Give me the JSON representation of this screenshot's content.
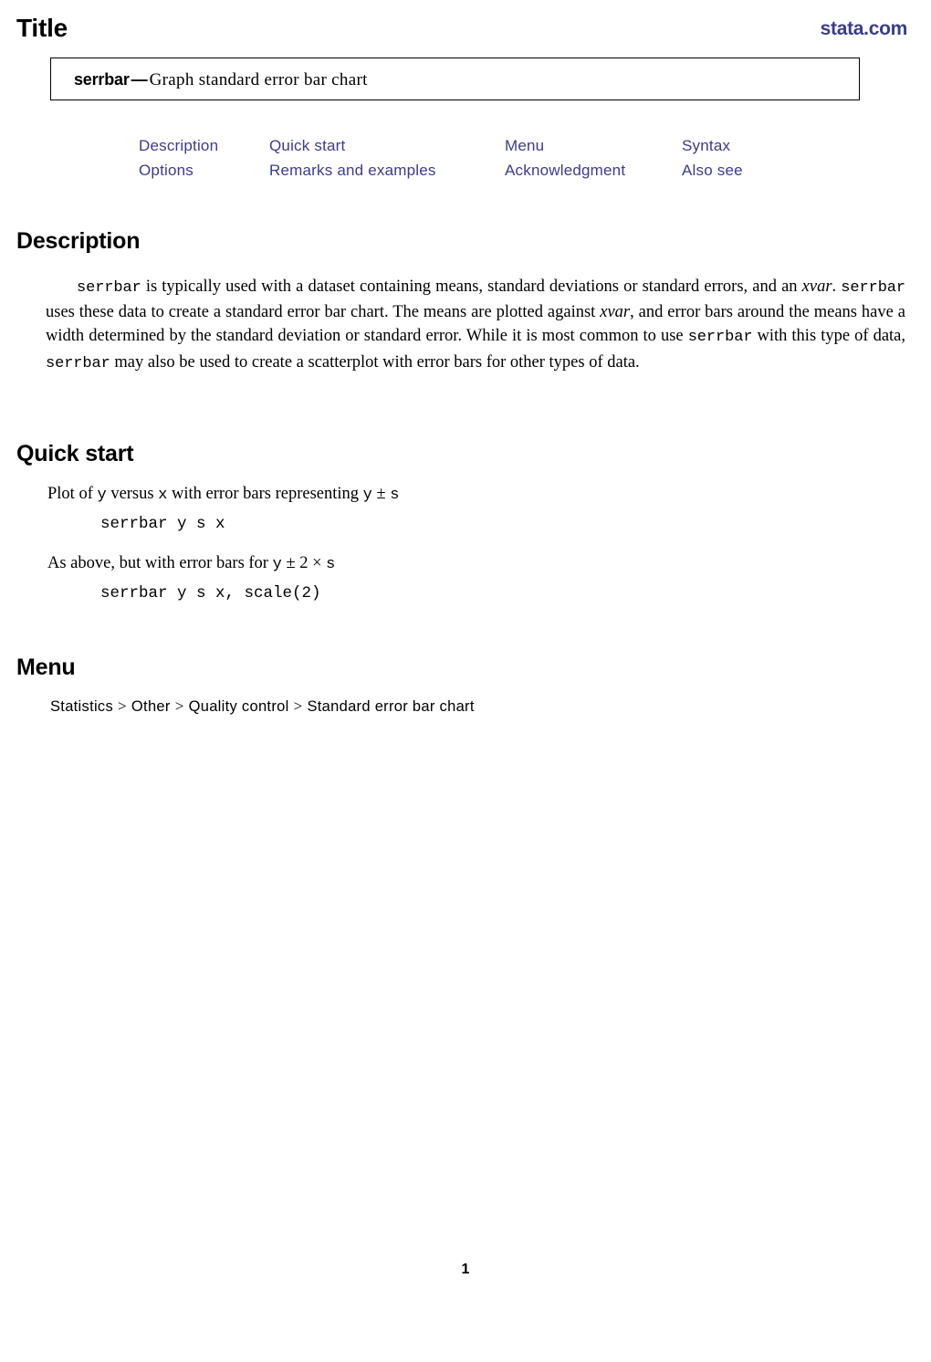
{
  "header": {
    "title": "Title",
    "site_link": "stata.com",
    "link_color": "#3b3b8f"
  },
  "title_box": {
    "command": "serrbar",
    "dash": "—",
    "description": "Graph standard error bar chart"
  },
  "nav_links": {
    "row1": [
      {
        "label": "Description"
      },
      {
        "label": "Quick start"
      },
      {
        "label": "Menu"
      },
      {
        "label": "Syntax"
      }
    ],
    "row2": [
      {
        "label": "Options"
      },
      {
        "label": "Remarks and examples"
      },
      {
        "label": "Acknowledgment"
      },
      {
        "label": "Also see"
      }
    ]
  },
  "sections": {
    "description": {
      "heading": "Description",
      "paragraph": {
        "p1_cmd": "serrbar",
        "p1_t1": " is typically used with a dataset containing means, standard deviations or standard errors, and an ",
        "p1_italic": "xvar",
        "p1_t2": ". ",
        "p1_cmd2": "serrbar",
        "p1_t3": " uses these data to create a standard error bar chart. The means are plotted against ",
        "p1_italic2": "xvar",
        "p1_t4": ", and error bars around the means have a width determined by the standard deviation or standard error. While it is most common to use ",
        "p1_cmd3": "serrbar",
        "p1_t5": " with this type of data, ",
        "p1_cmd4": "serrbar",
        "p1_t6": " may also be used to create a scatterplot with error bars for other types of data."
      }
    },
    "quick_start": {
      "heading": "Quick start",
      "items": [
        {
          "text_a": "Plot of ",
          "var1": "y",
          "text_b": " versus ",
          "var2": "x",
          "text_c": " with error bars representing ",
          "formula_var": "y",
          "formula_op": " ± ",
          "formula_var2": "s",
          "code": "serrbar y s x"
        },
        {
          "text_a": "As above, but with error bars for ",
          "formula_var": "y",
          "formula_op": " ± ",
          "formula_num": "2",
          "formula_times": " × ",
          "formula_var2": "s",
          "code": "serrbar y s x, scale(2)"
        }
      ]
    },
    "menu": {
      "heading": "Menu",
      "path": [
        "Statistics",
        "Other",
        "Quality control",
        "Standard error bar chart"
      ],
      "separator": ">"
    }
  },
  "footer": {
    "page_number": "1"
  }
}
